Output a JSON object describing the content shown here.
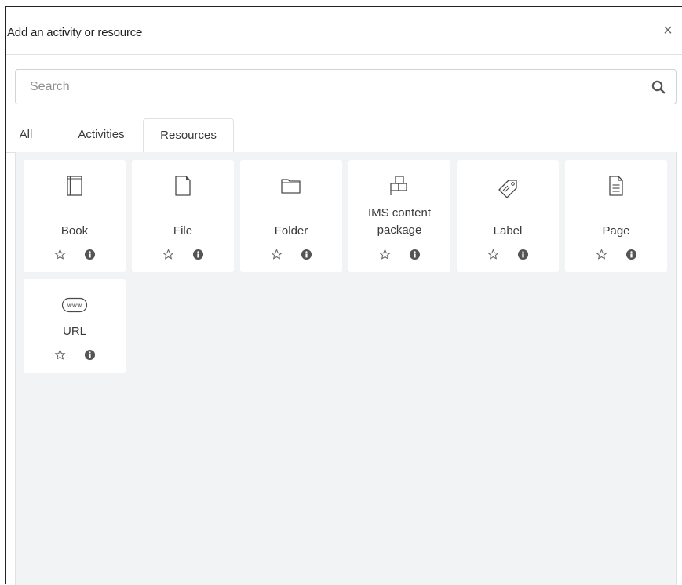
{
  "modal": {
    "title": "Add an activity or resource",
    "close_symbol": "×"
  },
  "search": {
    "placeholder": "Search",
    "value": "",
    "button_icon": "search-icon"
  },
  "tabs": [
    {
      "label": "All",
      "active": false
    },
    {
      "label": "Activities",
      "active": false
    },
    {
      "label": "Resources",
      "active": true
    }
  ],
  "resources": [
    {
      "label": "Book",
      "icon": "book-icon"
    },
    {
      "label": "File",
      "icon": "file-icon"
    },
    {
      "label": "Folder",
      "icon": "folder-icon"
    },
    {
      "label_line1": "IMS content",
      "label_line2": "package",
      "icon": "ims-package-icon"
    },
    {
      "label": "Label",
      "icon": "tag-icon"
    },
    {
      "label": "Page",
      "icon": "page-icon"
    },
    {
      "label": "URL",
      "icon": "www-icon"
    }
  ],
  "colors": {
    "content_bg": "#f2f3f5",
    "card_bg": "#ffffff",
    "icon_stroke": "#4a4a4a",
    "info_icon": "#555555"
  }
}
